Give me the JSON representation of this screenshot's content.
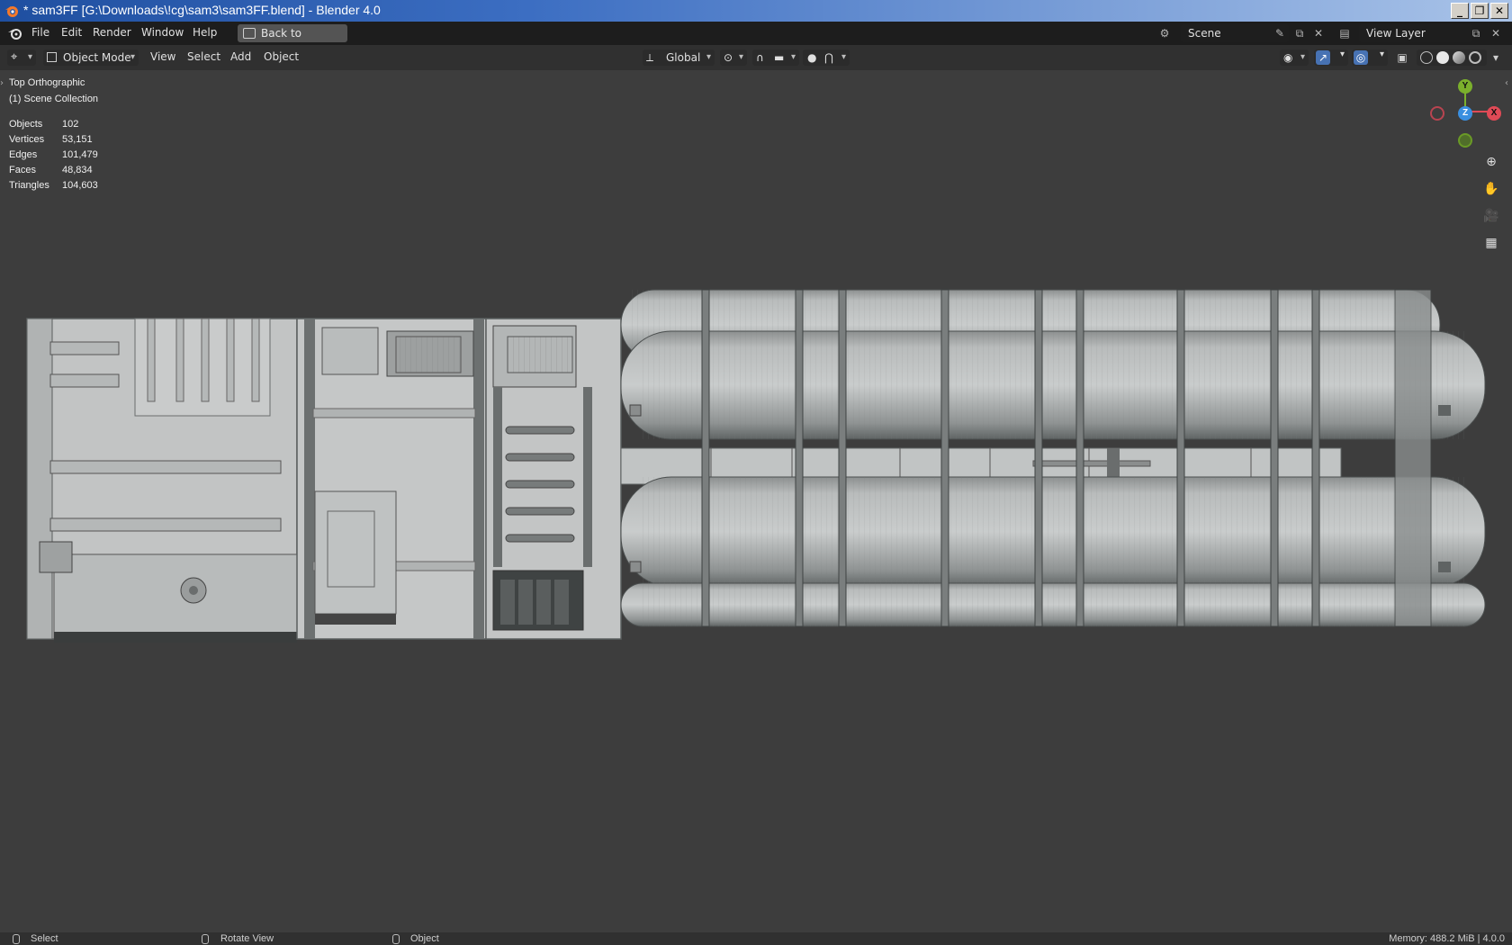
{
  "window": {
    "title": "* sam3FF [G:\\Downloads\\!cg\\sam3\\sam3FF.blend] - Blender 4.0",
    "buttons": [
      "_",
      "❐",
      "✕"
    ]
  },
  "menubar": {
    "items": [
      "File",
      "Edit",
      "Render",
      "Window",
      "Help"
    ],
    "back_button": "Back to Previous",
    "scene": "Scene",
    "view_layer": "View Layer"
  },
  "viewport_header": {
    "mode": "Object Mode",
    "menus": [
      "View",
      "Select",
      "Add",
      "Object"
    ],
    "transform_orientation": "Global"
  },
  "viewport": {
    "view_name": "Top Orthographic",
    "collection": "(1) Scene Collection",
    "stats": [
      {
        "label": "Objects",
        "value": "102"
      },
      {
        "label": "Vertices",
        "value": "53,151"
      },
      {
        "label": "Edges",
        "value": "101,479"
      },
      {
        "label": "Faces",
        "value": "48,834"
      },
      {
        "label": "Triangles",
        "value": "104,603"
      }
    ],
    "gizmo": {
      "y": "Y",
      "z": "Z",
      "x": "X",
      "colors": {
        "x": "#e04a56",
        "y": "#7bb02c",
        "z": "#3a8fe0"
      }
    }
  },
  "statusbar": {
    "select": "Select",
    "rotate": "Rotate View",
    "object": "Object",
    "memory": "Memory: 488.2 MiB | 4.0.0"
  }
}
